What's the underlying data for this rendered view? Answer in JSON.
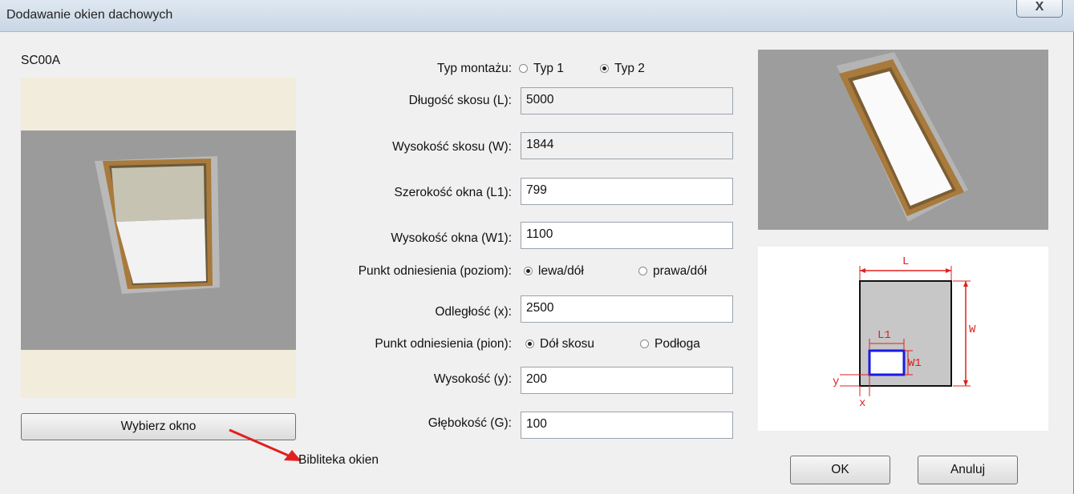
{
  "window": {
    "title": "Dodawanie okien dachowych",
    "close_glyph": "X"
  },
  "left": {
    "window_code": "SC00A",
    "choose_button": "Wybierz okno",
    "annotation": "Bibliteka okien"
  },
  "form": {
    "mount_type": {
      "label": "Typ montażu:",
      "options": [
        "Typ 1",
        "Typ 2"
      ],
      "selected": "Typ 2"
    },
    "slope_length": {
      "label": "Długość skosu (L):",
      "value": "5000"
    },
    "slope_height": {
      "label": "Wysokość skosu (W):",
      "value": "1844"
    },
    "window_width": {
      "label": "Szerokość okna (L1):",
      "value": "799"
    },
    "window_height": {
      "label": "Wysokość okna (W1):",
      "value": "1100"
    },
    "ref_horizontal": {
      "label": "Punkt odniesienia (poziom):",
      "options": [
        "lewa/dół",
        "prawa/dół"
      ],
      "selected": "lewa/dół"
    },
    "distance_x": {
      "label": "Odległość (x):",
      "value": "2500"
    },
    "ref_vertical": {
      "label": "Punkt odniesienia (pion):",
      "options": [
        "Dół skosu",
        "Podłoga"
      ],
      "selected": "Dół skosu"
    },
    "height_y": {
      "label": "Wysokość (y):",
      "value": "200"
    },
    "depth_g": {
      "label": "Głębokość (G):",
      "value": "100"
    }
  },
  "diagram": {
    "L": "L",
    "W": "W",
    "L1": "L1",
    "W1": "W1",
    "x": "x",
    "y": "y"
  },
  "buttons": {
    "ok": "OK",
    "cancel": "Anuluj"
  },
  "colors": {
    "accent_red": "#e02020",
    "window_blue": "#1a1ae6",
    "wood": "#a87a3c"
  }
}
